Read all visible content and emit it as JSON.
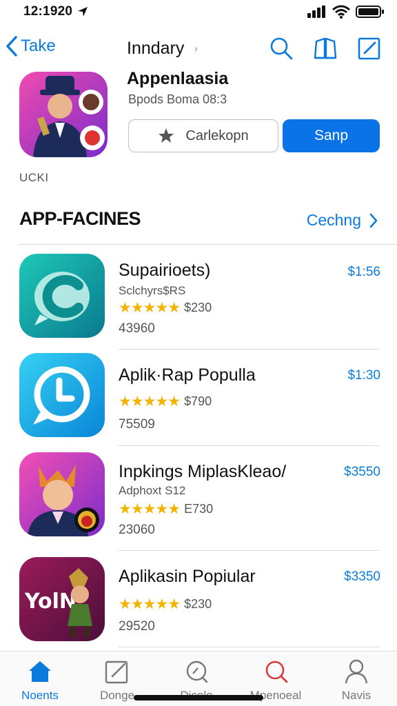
{
  "status": {
    "time": "12:1920"
  },
  "nav": {
    "back_label": "Take",
    "title": "Inndary",
    "title_chevron": "›"
  },
  "hero": {
    "title": "Appenlaasia",
    "subtitle": "Bpods Boma 08:3",
    "button_outline_label": "Carlekopn",
    "button_primary_label": "Sanp"
  },
  "small_label": "UCKI",
  "section": {
    "title": "APP-FACINES",
    "link_label": "Cechng"
  },
  "apps": [
    {
      "name": "Supairioets)",
      "developer": "Sclchyrs$RS",
      "stars": "★★★★★",
      "rating_price": "$230",
      "count": "43960",
      "price": "$1:56"
    },
    {
      "name": "Aplik·Rap Populla",
      "developer": "",
      "stars": "★★★★★",
      "rating_price": "$790",
      "count": "75509",
      "price": "$1:30"
    },
    {
      "name": "Inpkings MiplasKleao/",
      "developer": "Adphoxt S12",
      "stars": "★★★★★",
      "rating_price": "E730",
      "count": "23060",
      "price": "$3550"
    },
    {
      "name": "Aplikasin Popiular",
      "developer": "",
      "stars": "★★★★★",
      "rating_price": "$230",
      "count": "29520",
      "price": "$3350"
    }
  ],
  "app4_icon_text": "YolN",
  "tabs": [
    {
      "label": "Noents",
      "icon": "home-icon"
    },
    {
      "label": "Donge",
      "icon": "edit-icon"
    },
    {
      "label": "Dicolo",
      "icon": "search-icon"
    },
    {
      "label": "Mpenoeal",
      "icon": "search-red-icon"
    },
    {
      "label": "Navis",
      "icon": "profile-icon"
    }
  ],
  "colors": {
    "accent": "#0a7bdc",
    "primary_button": "#0a73e8",
    "star": "#f2b400",
    "search_red": "#d83a3a"
  }
}
